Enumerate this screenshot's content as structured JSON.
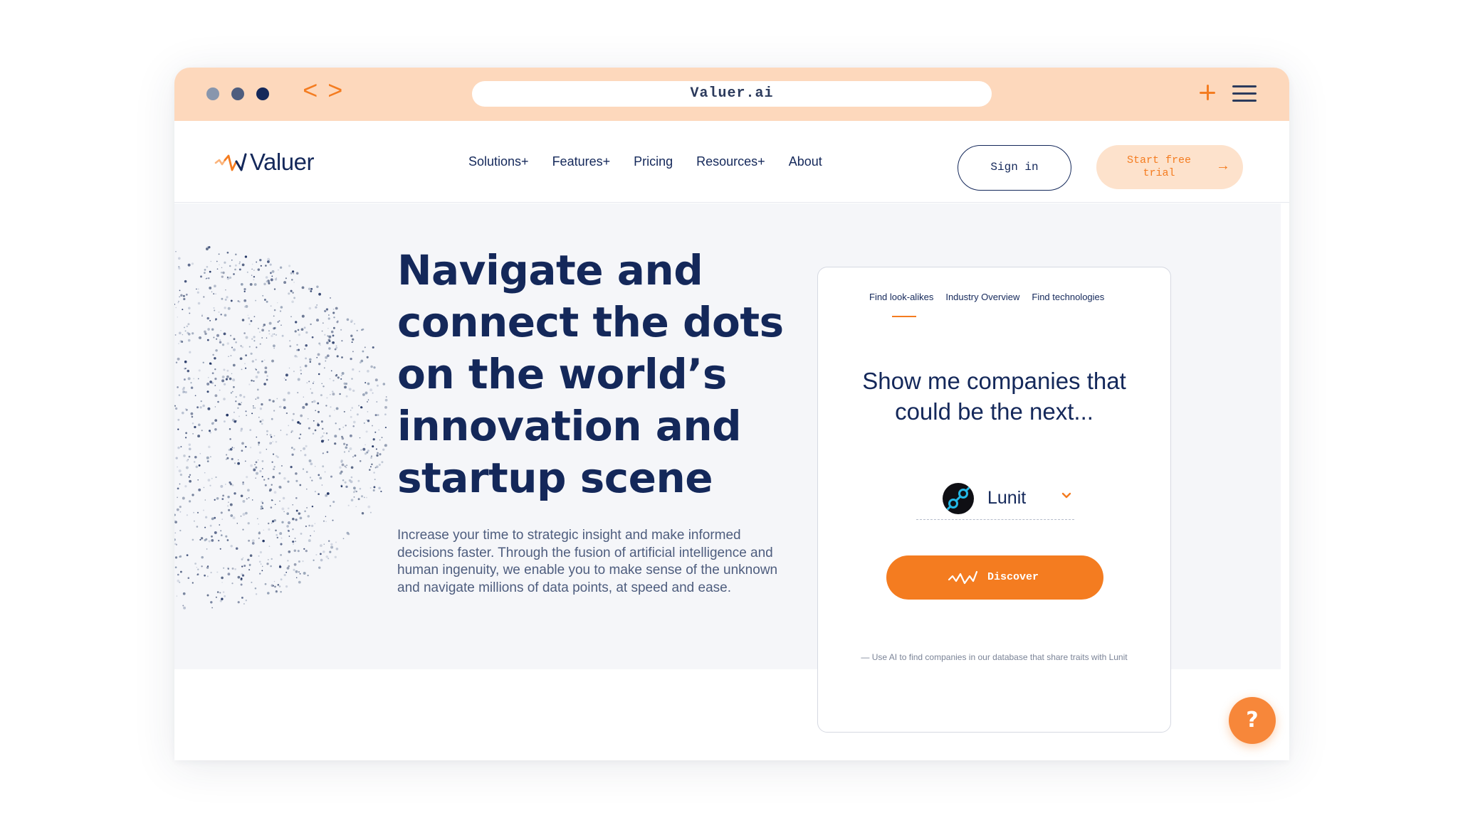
{
  "browser": {
    "url": "Valuer.ai",
    "back_icon": "<",
    "forward_icon": ">",
    "new_tab_icon": "plus-icon",
    "menu_icon": "hamburger-menu-icon"
  },
  "header": {
    "logo_text": "Valuer",
    "nav": [
      "Solutions+",
      "Features+",
      "Pricing",
      "Resources+",
      "About"
    ],
    "signin_label": "Sign in",
    "trial_label": "Start free trial",
    "trial_arrow": "→"
  },
  "hero": {
    "title": "Navigate and connect the dots on the world’s innovation and startup scene",
    "description": "Increase your time to strategic insight and make informed decisions faster. Through the fusion of artificial intelligence and human ingenuity, we enable you to make sense of the unknown and navigate millions of data points, at speed and ease."
  },
  "card": {
    "tabs": [
      "Find look-alikes",
      "Industry Overview",
      "Find technologies"
    ],
    "active_tab": "Find look-alikes",
    "heading": "Show me companies that could be the next...",
    "selected_company": "Lunit",
    "discover_label": "Discover",
    "note": "— Use AI to find companies in our database that share traits with Lunit"
  },
  "help": {
    "label": "?"
  },
  "colors": {
    "accent": "#f47c20",
    "navy": "#14285a",
    "chrome_bar": "#fdd8bc",
    "hero_bg": "#f5f6f9"
  }
}
